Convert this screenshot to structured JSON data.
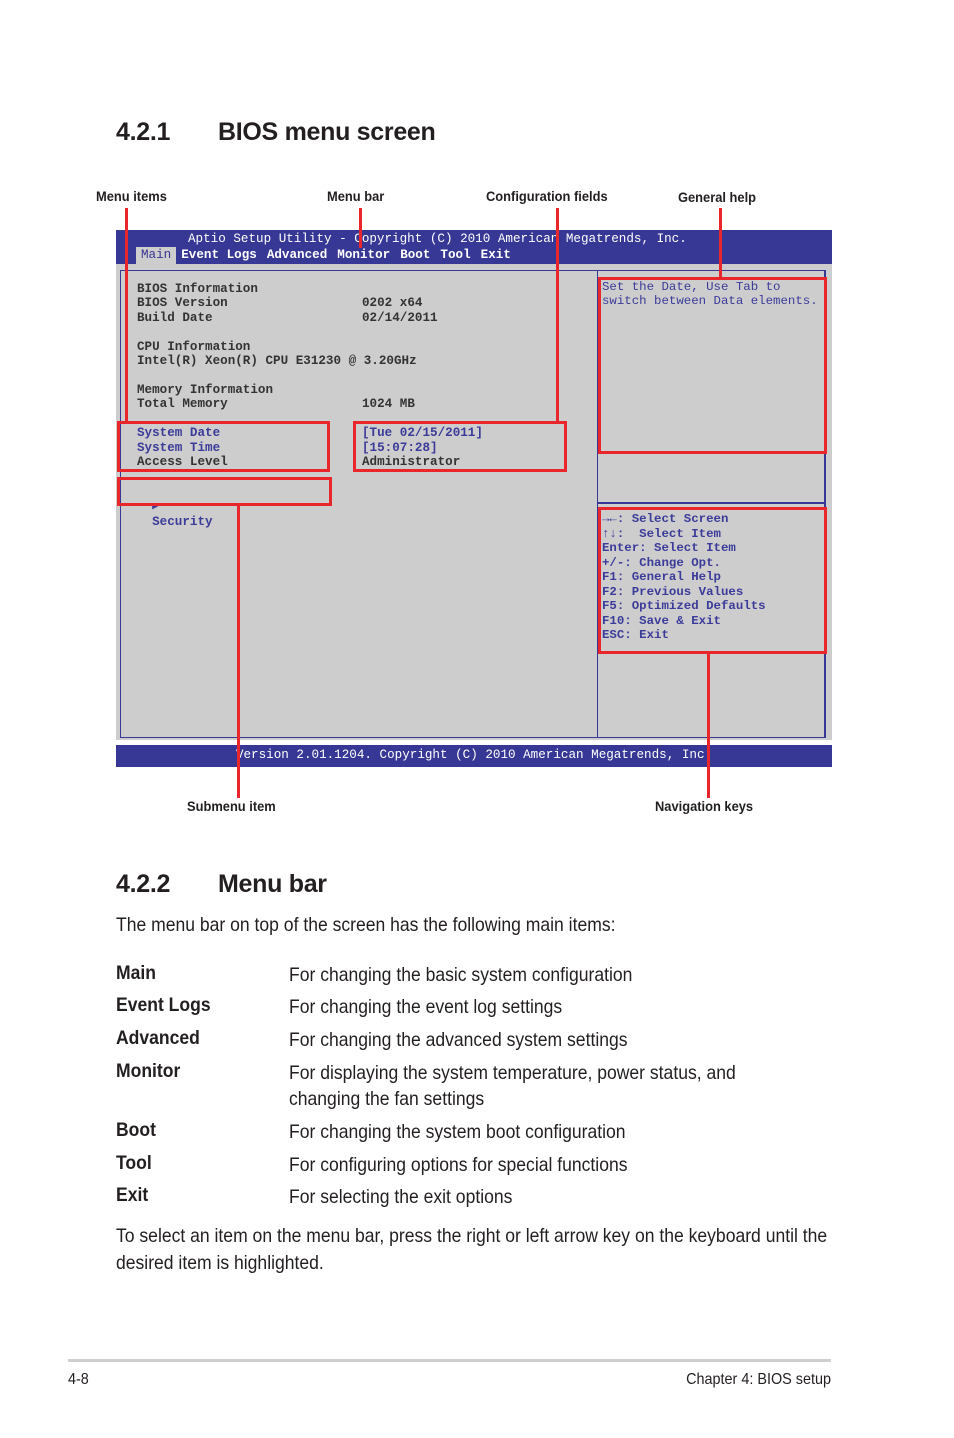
{
  "section1": {
    "number": "4.2.1",
    "title": "BIOS menu screen"
  },
  "callouts": {
    "menu_items": "Menu items",
    "menu_bar": "Menu bar",
    "config_fields": "Configuration fields",
    "general_help": "General help",
    "submenu_item": "Submenu item",
    "navigation_keys": "Navigation keys"
  },
  "bios": {
    "title": "Aptio Setup Utility - Copyright (C) 2010 American Megatrends, Inc.",
    "menu": [
      "Main",
      "Event Logs",
      "Advanced",
      "Monitor",
      "Boot",
      "Tool",
      "Exit"
    ],
    "active_menu": "Main",
    "info": [
      {
        "label": "BIOS Information",
        "value": ""
      },
      {
        "label": "BIOS Version",
        "value": "0202 x64"
      },
      {
        "label": "Build Date",
        "value": "02/14/2011"
      },
      {
        "label": "",
        "value": ""
      },
      {
        "label": "CPU Information",
        "value": ""
      },
      {
        "label": "Intel(R) Xeon(R) CPU E31230 @ 3.20GHz",
        "value": ""
      },
      {
        "label": "",
        "value": ""
      },
      {
        "label": "Memory Information",
        "value": ""
      },
      {
        "label": "Total Memory",
        "value": "1024 MB"
      }
    ],
    "settings": [
      {
        "label": "System Date",
        "value": "[Tue 02/15/2011]"
      },
      {
        "label": "System Time",
        "value": "[15:07:28]"
      },
      {
        "label": "Access Level",
        "value": "Administrator"
      }
    ],
    "submenu": {
      "label": "Security",
      "icon": "triangle-right-icon"
    },
    "help": [
      "Set the Date, Use Tab to",
      "switch between Data elements."
    ],
    "nav_keys": [
      "→←: Select Screen",
      "↑↓:  Select Item",
      "Enter: Select Item",
      "+/-: Change Opt.",
      "F1: General Help",
      "F2: Previous Values",
      "F5: Optimized Defaults",
      "F10: Save & Exit",
      "ESC: Exit"
    ],
    "footer": "Version 2.01.1204. Copyright (C) 2010 American Megatrends, Inc.",
    "colors": {
      "bar": "#373795",
      "panel": "#cdcdcd",
      "text_blue": "#3b3b9a",
      "callout_red": "#e8262b"
    }
  },
  "section2": {
    "number": "4.2.2",
    "title": "Menu bar",
    "intro": "The menu bar on top of the screen has the following main items:",
    "items": [
      {
        "term": "Main",
        "desc": "For changing the basic system configuration"
      },
      {
        "term": "Event Logs",
        "desc": "For changing the event log settings"
      },
      {
        "term": "Advanced",
        "desc": "For changing the advanced system settings"
      },
      {
        "term": "Monitor",
        "desc": "For displaying the system temperature, power status, and",
        "desc2": "changing the fan settings"
      },
      {
        "term": "Boot",
        "desc": "For changing the system boot configuration"
      },
      {
        "term": "Tool",
        "desc": "For configuring options for special functions"
      },
      {
        "term": "Exit",
        "desc": "For selecting the exit options"
      }
    ],
    "outro": "To select an item on the menu bar, press the right or left arrow key on the keyboard until the desired item is highlighted."
  },
  "footer": {
    "page": "4-8",
    "chapter": "Chapter 4: BIOS setup"
  }
}
